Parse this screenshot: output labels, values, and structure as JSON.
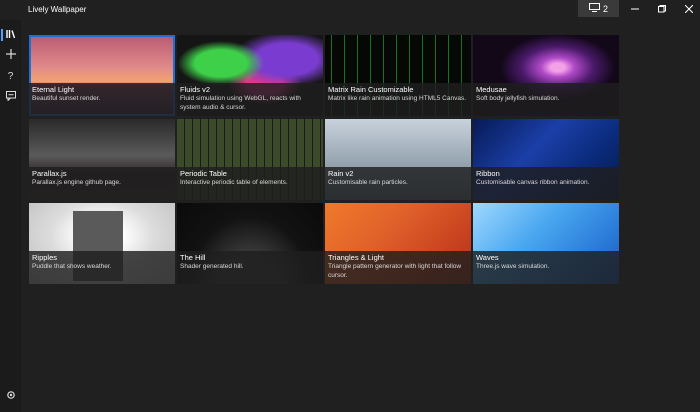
{
  "window": {
    "title": "Lively Wallpaper",
    "monitor_count": "2"
  },
  "sidebar": {
    "items": [
      {
        "name": "library-icon",
        "active": true
      },
      {
        "name": "add-icon",
        "active": false
      },
      {
        "name": "help-icon",
        "active": false
      },
      {
        "name": "feedback-icon",
        "active": false
      },
      {
        "name": "settings-icon",
        "active": false
      }
    ]
  },
  "wallpapers": [
    {
      "title": "Eternal Light",
      "description": "Beautiful sunset render.",
      "selected": true
    },
    {
      "title": "Fluids v2",
      "description": "Fluid simulation using WebGL, reacts with system audio & cursor.",
      "selected": false
    },
    {
      "title": "Matrix Rain Customizable",
      "description": "Matrix like rain animation using HTML5 Canvas.",
      "selected": false
    },
    {
      "title": "Medusae",
      "description": "Soft body jellyfish simulation.",
      "selected": false
    },
    {
      "title": "Parallax.js",
      "description": "Parallax.js engine github page.",
      "selected": false
    },
    {
      "title": "Periodic Table",
      "description": "Interactive periodic table of elements.",
      "selected": false
    },
    {
      "title": "Rain v2",
      "description": "Customisable rain particles.",
      "selected": false
    },
    {
      "title": "Ribbon",
      "description": "Customisable canvas ribbon animation.",
      "selected": false
    },
    {
      "title": "Ripples",
      "description": "Puddle that shows weather.",
      "selected": false
    },
    {
      "title": "The Hill",
      "description": "Shader generated hill.",
      "selected": false
    },
    {
      "title": "Triangles & Light",
      "description": "Triangle pattern generator with light that follow cursor.",
      "selected": false
    },
    {
      "title": "Waves",
      "description": "Three.js wave simulation.",
      "selected": false
    }
  ],
  "colors": {
    "accent": "#1e6fd8",
    "background": "#202020",
    "sidebar": "#1b1b1b"
  }
}
